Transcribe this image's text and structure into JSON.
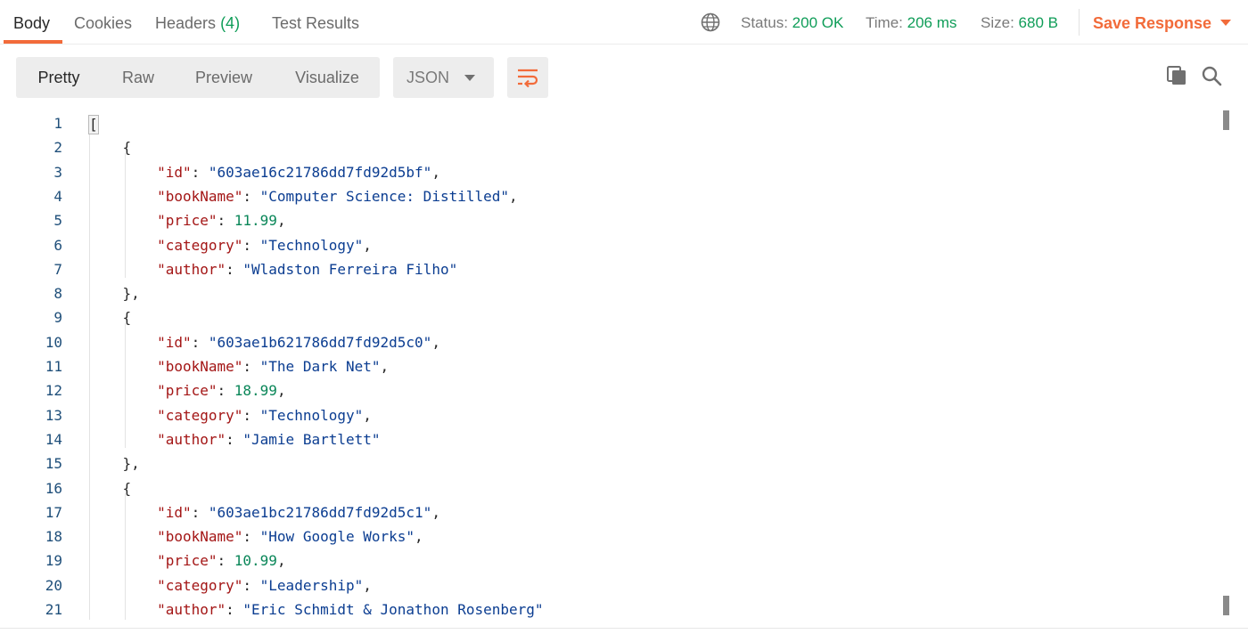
{
  "tabs": [
    {
      "label": "Body",
      "active": true
    },
    {
      "label": "Cookies"
    },
    {
      "label": "Headers",
      "count": "(4)"
    },
    {
      "label": "Test Results"
    }
  ],
  "status": {
    "status_label": "Status:",
    "status_value": "200 OK",
    "time_label": "Time:",
    "time_value": "206 ms",
    "size_label": "Size:",
    "size_value": "680 B"
  },
  "save_response": {
    "label": "Save Response"
  },
  "view_modes": [
    {
      "label": "Pretty",
      "active": true
    },
    {
      "label": "Raw"
    },
    {
      "label": "Preview"
    },
    {
      "label": "Visualize"
    }
  ],
  "format": {
    "selected": "JSON"
  },
  "icons": {
    "globe": "globe-icon",
    "wrap": "wrap-lines-icon",
    "copy": "copy-icon",
    "search": "search-icon"
  },
  "colors": {
    "accent": "#f26b3a",
    "success": "#0f9d58",
    "json_key": "#a31515",
    "json_string": "#0b3d91",
    "json_number": "#098658"
  },
  "code_lines": [
    {
      "n": "1",
      "tokens": [
        {
          "t": "p",
          "v": "["
        }
      ]
    },
    {
      "n": "2",
      "tokens": [
        {
          "t": "p",
          "v": "    {"
        }
      ]
    },
    {
      "n": "3",
      "tokens": [
        {
          "t": "p",
          "v": "        "
        },
        {
          "t": "k",
          "v": "\"id\""
        },
        {
          "t": "p",
          "v": ": "
        },
        {
          "t": "s",
          "v": "\"603ae16c21786dd7fd92d5bf\""
        },
        {
          "t": "p",
          "v": ","
        }
      ]
    },
    {
      "n": "4",
      "tokens": [
        {
          "t": "p",
          "v": "        "
        },
        {
          "t": "k",
          "v": "\"bookName\""
        },
        {
          "t": "p",
          "v": ": "
        },
        {
          "t": "s",
          "v": "\"Computer Science: Distilled\""
        },
        {
          "t": "p",
          "v": ","
        }
      ]
    },
    {
      "n": "5",
      "tokens": [
        {
          "t": "p",
          "v": "        "
        },
        {
          "t": "k",
          "v": "\"price\""
        },
        {
          "t": "p",
          "v": ": "
        },
        {
          "t": "n",
          "v": "11.99"
        },
        {
          "t": "p",
          "v": ","
        }
      ]
    },
    {
      "n": "6",
      "tokens": [
        {
          "t": "p",
          "v": "        "
        },
        {
          "t": "k",
          "v": "\"category\""
        },
        {
          "t": "p",
          "v": ": "
        },
        {
          "t": "s",
          "v": "\"Technology\""
        },
        {
          "t": "p",
          "v": ","
        }
      ]
    },
    {
      "n": "7",
      "tokens": [
        {
          "t": "p",
          "v": "        "
        },
        {
          "t": "k",
          "v": "\"author\""
        },
        {
          "t": "p",
          "v": ": "
        },
        {
          "t": "s",
          "v": "\"Wladston Ferreira Filho\""
        }
      ]
    },
    {
      "n": "8",
      "tokens": [
        {
          "t": "p",
          "v": "    },"
        }
      ]
    },
    {
      "n": "9",
      "tokens": [
        {
          "t": "p",
          "v": "    {"
        }
      ]
    },
    {
      "n": "10",
      "tokens": [
        {
          "t": "p",
          "v": "        "
        },
        {
          "t": "k",
          "v": "\"id\""
        },
        {
          "t": "p",
          "v": ": "
        },
        {
          "t": "s",
          "v": "\"603ae1b621786dd7fd92d5c0\""
        },
        {
          "t": "p",
          "v": ","
        }
      ]
    },
    {
      "n": "11",
      "tokens": [
        {
          "t": "p",
          "v": "        "
        },
        {
          "t": "k",
          "v": "\"bookName\""
        },
        {
          "t": "p",
          "v": ": "
        },
        {
          "t": "s",
          "v": "\"The Dark Net\""
        },
        {
          "t": "p",
          "v": ","
        }
      ]
    },
    {
      "n": "12",
      "tokens": [
        {
          "t": "p",
          "v": "        "
        },
        {
          "t": "k",
          "v": "\"price\""
        },
        {
          "t": "p",
          "v": ": "
        },
        {
          "t": "n",
          "v": "18.99"
        },
        {
          "t": "p",
          "v": ","
        }
      ]
    },
    {
      "n": "13",
      "tokens": [
        {
          "t": "p",
          "v": "        "
        },
        {
          "t": "k",
          "v": "\"category\""
        },
        {
          "t": "p",
          "v": ": "
        },
        {
          "t": "s",
          "v": "\"Technology\""
        },
        {
          "t": "p",
          "v": ","
        }
      ]
    },
    {
      "n": "14",
      "tokens": [
        {
          "t": "p",
          "v": "        "
        },
        {
          "t": "k",
          "v": "\"author\""
        },
        {
          "t": "p",
          "v": ": "
        },
        {
          "t": "s",
          "v": "\"Jamie Bartlett\""
        }
      ]
    },
    {
      "n": "15",
      "tokens": [
        {
          "t": "p",
          "v": "    },"
        }
      ]
    },
    {
      "n": "16",
      "tokens": [
        {
          "t": "p",
          "v": "    {"
        }
      ]
    },
    {
      "n": "17",
      "tokens": [
        {
          "t": "p",
          "v": "        "
        },
        {
          "t": "k",
          "v": "\"id\""
        },
        {
          "t": "p",
          "v": ": "
        },
        {
          "t": "s",
          "v": "\"603ae1bc21786dd7fd92d5c1\""
        },
        {
          "t": "p",
          "v": ","
        }
      ]
    },
    {
      "n": "18",
      "tokens": [
        {
          "t": "p",
          "v": "        "
        },
        {
          "t": "k",
          "v": "\"bookName\""
        },
        {
          "t": "p",
          "v": ": "
        },
        {
          "t": "s",
          "v": "\"How Google Works\""
        },
        {
          "t": "p",
          "v": ","
        }
      ]
    },
    {
      "n": "19",
      "tokens": [
        {
          "t": "p",
          "v": "        "
        },
        {
          "t": "k",
          "v": "\"price\""
        },
        {
          "t": "p",
          "v": ": "
        },
        {
          "t": "n",
          "v": "10.99"
        },
        {
          "t": "p",
          "v": ","
        }
      ]
    },
    {
      "n": "20",
      "tokens": [
        {
          "t": "p",
          "v": "        "
        },
        {
          "t": "k",
          "v": "\"category\""
        },
        {
          "t": "p",
          "v": ": "
        },
        {
          "t": "s",
          "v": "\"Leadership\""
        },
        {
          "t": "p",
          "v": ","
        }
      ]
    },
    {
      "n": "21",
      "tokens": [
        {
          "t": "p",
          "v": "        "
        },
        {
          "t": "k",
          "v": "\"author\""
        },
        {
          "t": "p",
          "v": ": "
        },
        {
          "t": "s",
          "v": "\"Eric Schmidt & Jonathon Rosenberg\""
        }
      ]
    }
  ]
}
